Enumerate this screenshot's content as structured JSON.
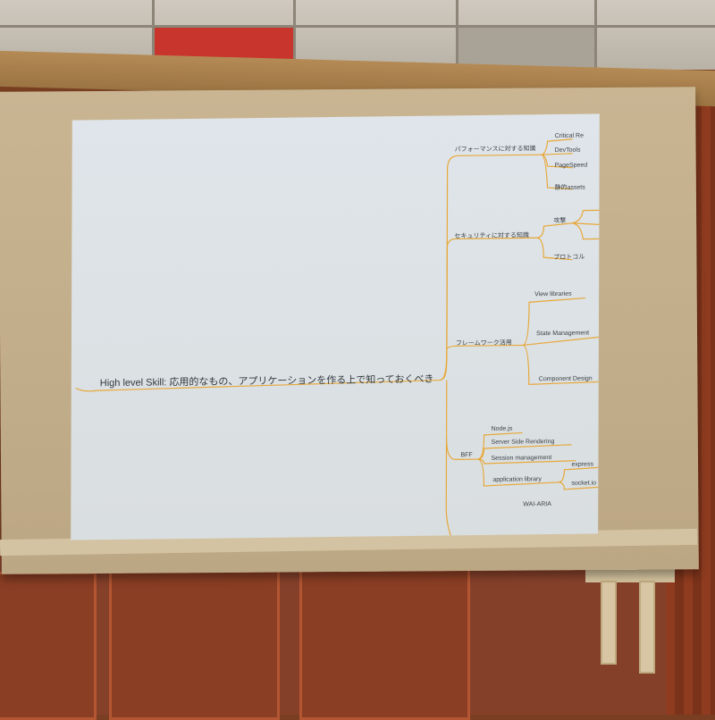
{
  "slide": {
    "root": "High level Skill: 応用的なもの、アプリケーションを作る上で知っておくべき",
    "branches": [
      {
        "label": "パフォーマンスに対する知識",
        "children": [
          "Critical Re",
          "DevTools",
          "PageSpeed",
          "静的assets"
        ]
      },
      {
        "label": "セキュリティに対する知識",
        "children": [
          "攻撃",
          "プロトコル"
        ]
      },
      {
        "label": "フレームワーク活用",
        "children": [
          "View libraries",
          "State Management",
          "Component Design"
        ]
      },
      {
        "label": "BFF",
        "children": [
          "Node.js",
          "Server Side Rendering",
          "Session management",
          "application library"
        ],
        "grandchildren": [
          "express",
          "socket.io"
        ]
      },
      {
        "label": "WAI-ARIA",
        "children": []
      }
    ]
  },
  "colors": {
    "line": "#e7a83a",
    "slide_bg": "#dde3e7",
    "wall": "#7a3f22",
    "ceiling_red": "#c8352c"
  }
}
